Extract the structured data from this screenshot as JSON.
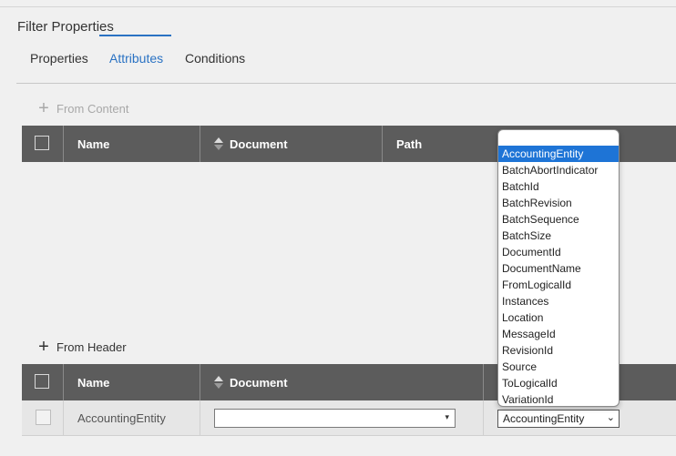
{
  "panel": {
    "title": "Filter Properties"
  },
  "tabs": [
    {
      "label": "Properties"
    },
    {
      "label": "Attributes"
    },
    {
      "label": "Conditions"
    }
  ],
  "active_tab": "Attributes",
  "from_content": {
    "action_label": "From Content",
    "columns": {
      "name": "Name",
      "document": "Document",
      "path": "Path"
    }
  },
  "from_header": {
    "action_label": "From Header",
    "columns": {
      "name": "Name",
      "document": "Document"
    },
    "rows": [
      {
        "name": "AccountingEntity",
        "document": "",
        "path": "AccountingEntity"
      }
    ]
  },
  "path_dropdown": {
    "selected": "AccountingEntity",
    "options": [
      "",
      "AccountingEntity",
      "BatchAbortIndicator",
      "BatchId",
      "BatchRevision",
      "BatchSequence",
      "BatchSize",
      "DocumentId",
      "DocumentName",
      "FromLogicalId",
      "Instances",
      "Location",
      "MessageId",
      "RevisionId",
      "Source",
      "ToLogicalId",
      "VariationId"
    ]
  },
  "colors": {
    "accent": "#2a72c3",
    "grid_header": "#5c5c5c",
    "selected_option": "#1e74d6"
  }
}
